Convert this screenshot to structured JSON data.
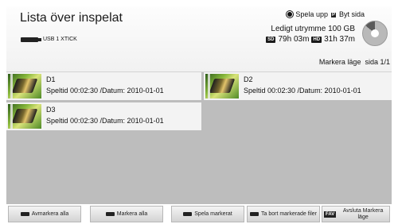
{
  "header": {
    "title": "Lista över inspelat",
    "device": "USB 1 XTICK",
    "play_label": "Spela upp",
    "page_label": "Byt sida",
    "page_key": "P",
    "free_space": "Ledigt utrymme 100 GB",
    "sd_badge": "SD",
    "sd_time": "79h 03m",
    "hd_badge": "HD",
    "hd_time": "31h 37m",
    "mark_mode": "Markera läge",
    "page": "sida 1/1",
    "disc_used_fraction": 0.86
  },
  "recordings": [
    {
      "name": "D1",
      "info": "Speltid 00:02:30 /Datum: 2010-01-01"
    },
    {
      "name": "D2",
      "info": "Speltid 00:02:30 /Datum: 2010-01-01"
    },
    {
      "name": "D3",
      "info": "Speltid 00:02:30 /Datum: 2010-01-01"
    }
  ],
  "footer": {
    "unmark_all": "Avmarkera alla",
    "mark_all": "Markera alla",
    "play_marked": "Spela markerat",
    "delete_marked": "Ta bort markerade filer",
    "fav_key": "FAV",
    "exit_mark": "Avsluta Markera läge"
  }
}
